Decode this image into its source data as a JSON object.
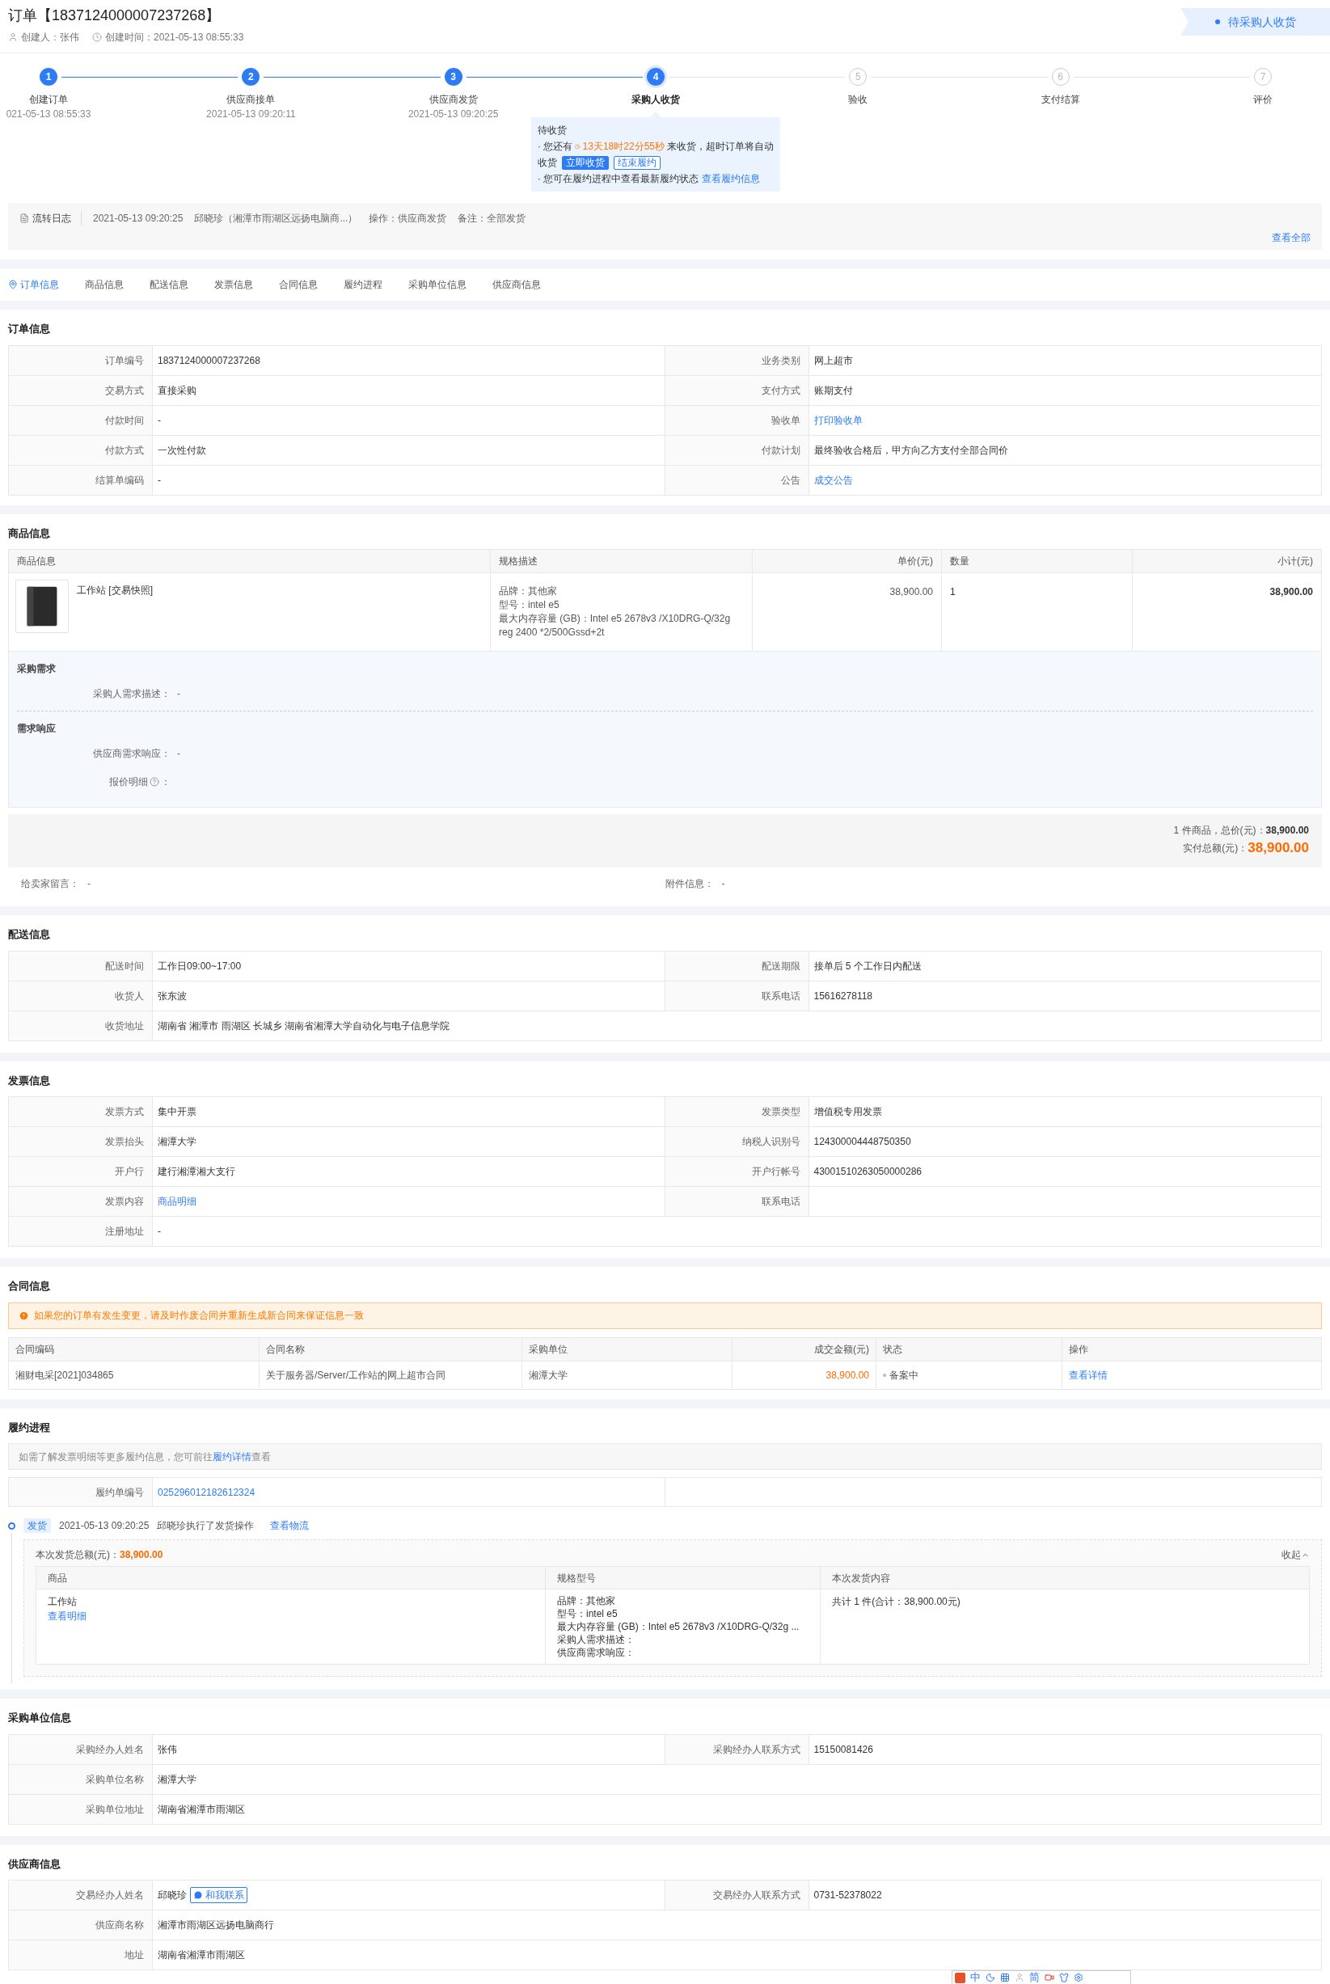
{
  "header": {
    "title": "订单【1837124000007237268】",
    "creator": "创建人：张伟",
    "created": "创建时间：2021-05-13 08:55:33",
    "status": "待采购人收货"
  },
  "steps": [
    {
      "number": "1",
      "label": "创建订单",
      "time": "021-05-13 08:55:33",
      "completed": true,
      "selected": false
    },
    {
      "number": "2",
      "label": "供应商接单",
      "time": "2021-05-13 09:20:11",
      "completed": true,
      "selected": false
    },
    {
      "number": "3",
      "label": "供应商发货",
      "time": "2021-05-13 09:20:25",
      "completed": true,
      "selected": false
    },
    {
      "number": "4",
      "label": "采购人收货",
      "completed": false,
      "selected": true
    },
    {
      "number": "5",
      "label": "验收",
      "completed": false,
      "selected": false
    },
    {
      "number": "6",
      "label": "支付结算",
      "completed": false,
      "selected": false
    },
    {
      "number": "7",
      "label": "评价",
      "completed": false,
      "selected": false
    }
  ],
  "step_popup": {
    "title": "待收货",
    "line1_prefix": "· 您还有",
    "countdown": "13天18时22分55秒",
    "line1_suffix": "来收货，超时订单将自动",
    "line2_prefix": "收货",
    "buttons": [
      {
        "label": "立即收货",
        "kind": "primary"
      },
      {
        "label": "结束履约",
        "kind": "outline"
      }
    ],
    "line3": "· 您可在履约进程中查看最新履约状态",
    "line3_link": "查看履约信息"
  },
  "log": {
    "label": "流转日志",
    "time": "2021-05-13 09:20:25",
    "operator": "邱晓珍（湘潭市雨湖区远扬电脑商...）",
    "action": "操作：供应商发货",
    "note": "备注：全部发货",
    "view_all": "查看全部"
  },
  "tabs": [
    {
      "label": "订单信息",
      "selected": true
    },
    {
      "label": "商品信息",
      "selected": false
    },
    {
      "label": "配送信息",
      "selected": false
    },
    {
      "label": "发票信息",
      "selected": false
    },
    {
      "label": "合同信息",
      "selected": false
    },
    {
      "label": "履约进程",
      "selected": false
    },
    {
      "label": "采购单位信息",
      "selected": false
    },
    {
      "label": "供应商信息",
      "selected": false
    }
  ],
  "order_info": {
    "title": "订单信息",
    "rows": [
      [
        {
          "label": "订单编号",
          "value": "1837124000007237268",
          "link": false
        },
        {
          "label": "业务类别",
          "value": "网上超市",
          "link": false
        }
      ],
      [
        {
          "label": "交易方式",
          "value": "直接采购",
          "link": false
        },
        {
          "label": "支付方式",
          "value": "账期支付",
          "link": false
        }
      ],
      [
        {
          "label": "付款时间",
          "value": "-",
          "link": false
        },
        {
          "label": "验收单",
          "value": "打印验收单",
          "link": true
        }
      ],
      [
        {
          "label": "付款方式",
          "value": "一次性付款",
          "link": false
        },
        {
          "label": "付款计划",
          "value": "最终验收合格后，甲方向乙方支付全部合同价",
          "link": false
        }
      ],
      [
        {
          "label": "结算单编码",
          "value": "-",
          "link": false
        },
        {
          "label": "公告",
          "value": "成交公告",
          "link": true
        }
      ]
    ]
  },
  "goods": {
    "title": "商品信息",
    "columns": [
      "商品信息",
      "规格描述",
      "单价(元)",
      "数量",
      "小计(元)"
    ],
    "items": [
      {
        "name": "工作站 [交易快照]",
        "spec": [
          "品牌：其他家",
          "型号：intel e5",
          "最大内存容量 (GB)：Intel e5 2678v3 /X10DRG-Q/32g reg 2400 *2/500Gssd+2t"
        ],
        "price": "38,900.00",
        "qty": "1",
        "subtotal": "38,900.00"
      }
    ],
    "demand_groups": [
      {
        "title": "采购需求",
        "fields": [
          {
            "label": "采购人需求描述：",
            "value": "-"
          }
        ]
      },
      {
        "title": "需求响应",
        "fields": [
          {
            "label": "供应商需求响应：",
            "value": "-"
          },
          {
            "label": "报价明细",
            "suffix": "：",
            "help": true
          }
        ]
      }
    ],
    "summary": {
      "count_text": "1 件商品，总价(元)：",
      "total": "38,900.00",
      "paid_label": "实付总额(元)：",
      "paid": "38,900.00"
    },
    "messages": [
      {
        "label": "给卖家留言：",
        "value": "-"
      },
      {
        "label": "附件信息：",
        "value": "-"
      }
    ]
  },
  "delivery": {
    "title": "配送信息",
    "rows": [
      [
        {
          "label": "配送时间",
          "value": "工作日09:00~17:00",
          "link": false
        },
        {
          "label": "配送期限",
          "value": "接单后 5 个工作日内配送",
          "link": false
        }
      ],
      [
        {
          "label": "收货人",
          "value": "张东波",
          "link": false
        },
        {
          "label": "联系电话",
          "value": "15616278118",
          "link": false
        }
      ],
      [
        {
          "label": "收货地址",
          "value": "湖南省 湘潭市 雨湖区 长城乡 湖南省湘潭大学自动化与电子信息学院",
          "link": false
        }
      ]
    ]
  },
  "invoice": {
    "title": "发票信息",
    "rows": [
      [
        {
          "label": "发票方式",
          "value": "集中开票",
          "link": false
        },
        {
          "label": "发票类型",
          "value": "增值税专用发票",
          "link": false
        }
      ],
      [
        {
          "label": "发票抬头",
          "value": "湘潭大学",
          "link": false
        },
        {
          "label": "纳税人识别号",
          "value": "124300004448750350",
          "link": false
        }
      ],
      [
        {
          "label": "开户行",
          "value": "建行湘潭湘大支行",
          "link": false
        },
        {
          "label": "开户行帐号",
          "value": "43001510263050000286",
          "link": false
        }
      ],
      [
        {
          "label": "发票内容",
          "value": "商品明细",
          "link": true
        },
        {
          "label": "联系电话",
          "link": false
        }
      ],
      [
        {
          "label": "注册地址",
          "value": "-",
          "link": false
        }
      ]
    ]
  },
  "contract": {
    "title": "合同信息",
    "alert": "如果您的订单有发生变更，请及时作废合同并重新生成新合同来保证信息一致",
    "columns": [
      "合同编码",
      "合同名称",
      "采购单位",
      "成交金额(元)",
      "状态",
      "操作"
    ],
    "rows": [
      {
        "code": "湘财电采[2021]034865",
        "name": "关于服务器/Server/工作站的网上超市合同",
        "unit": "湘潭大学",
        "amount": "38,900.00",
        "status": "备案中",
        "action": "查看详情"
      }
    ]
  },
  "fulfillment": {
    "title": "履约进程",
    "notice_prefix": "如需了解发票明细等更多履约信息，您可前往",
    "notice_link": "履约详情",
    "notice_suffix": "查看",
    "number_label": "履约单编号",
    "number": "025296012182612324",
    "events": [
      {
        "tag": "发货",
        "time": "2021-05-13 09:20:25",
        "text": "邱晓珍执行了发货操作",
        "link": "查看物流",
        "total_label": "本次发货总额(元)：",
        "total": "38,900.00",
        "collapse": "收起",
        "columns": [
          "商品",
          "规格型号",
          "本次发货内容"
        ],
        "rows": [
          {
            "name": "工作站",
            "link": "查看明细",
            "spec": [
              "品牌：其他家",
              "型号：intel e5",
              "最大内存容量 (GB)：Intel e5 2678v3 /X10DRG-Q/32g ...",
              "采购人需求描述：",
              "供应商需求响应："
            ],
            "content": "共计 1 件(合计：38,900.00元)"
          }
        ]
      }
    ]
  },
  "buyer": {
    "title": "采购单位信息",
    "rows": [
      [
        {
          "label": "采购经办人姓名",
          "value": "张伟",
          "link": false
        },
        {
          "label": "采购经办人联系方式",
          "value": "15150081426",
          "link": false
        }
      ],
      [
        {
          "label": "采购单位名称",
          "value": "湘潭大学",
          "link": false
        }
      ],
      [
        {
          "label": "采购单位地址",
          "value": "湖南省湘潭市雨湖区",
          "link": false
        }
      ]
    ]
  },
  "supplier": {
    "title": "供应商信息",
    "rows": [
      [
        {
          "label": "交易经办人姓名",
          "value": "邱晓珍",
          "contact": "和我联系",
          "link": false
        },
        {
          "label": "交易经办人联系方式",
          "value": "0731-52378022",
          "link": false
        }
      ],
      [
        {
          "label": "供应商名称",
          "value": "湘潭市雨湖区远扬电脑商行",
          "link": false
        }
      ],
      [
        {
          "label": "地址",
          "value": "湖南省湘潭市雨湖区",
          "link": false
        }
      ]
    ]
  },
  "ime_bar": {
    "mode": "中",
    "charset": "简"
  }
}
